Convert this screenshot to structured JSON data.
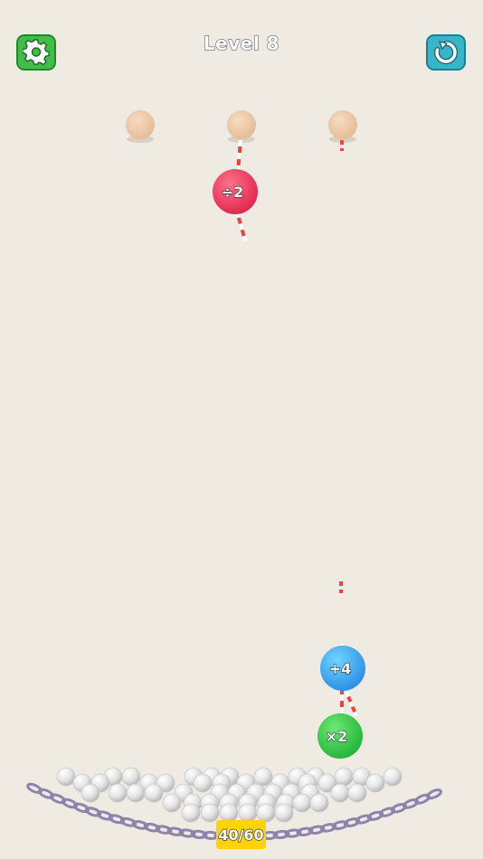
{
  "header": {
    "level_title": "Level 8",
    "settings_icon": "gear-icon",
    "restart_icon": "restart-icon"
  },
  "operators": {
    "divide": {
      "label": "÷2",
      "color": "#ef3f62"
    },
    "add": {
      "label": "+4",
      "color": "#3aa7ee"
    },
    "multiply": {
      "label": "×2",
      "color": "#3ecb4e"
    }
  },
  "counter": {
    "label": "40/60",
    "color": "#ffd400"
  },
  "colors": {
    "background": "#efebe3",
    "peg": "#ecc9a6",
    "chain": "#8d84ad",
    "ball": "#e6e6e6"
  }
}
